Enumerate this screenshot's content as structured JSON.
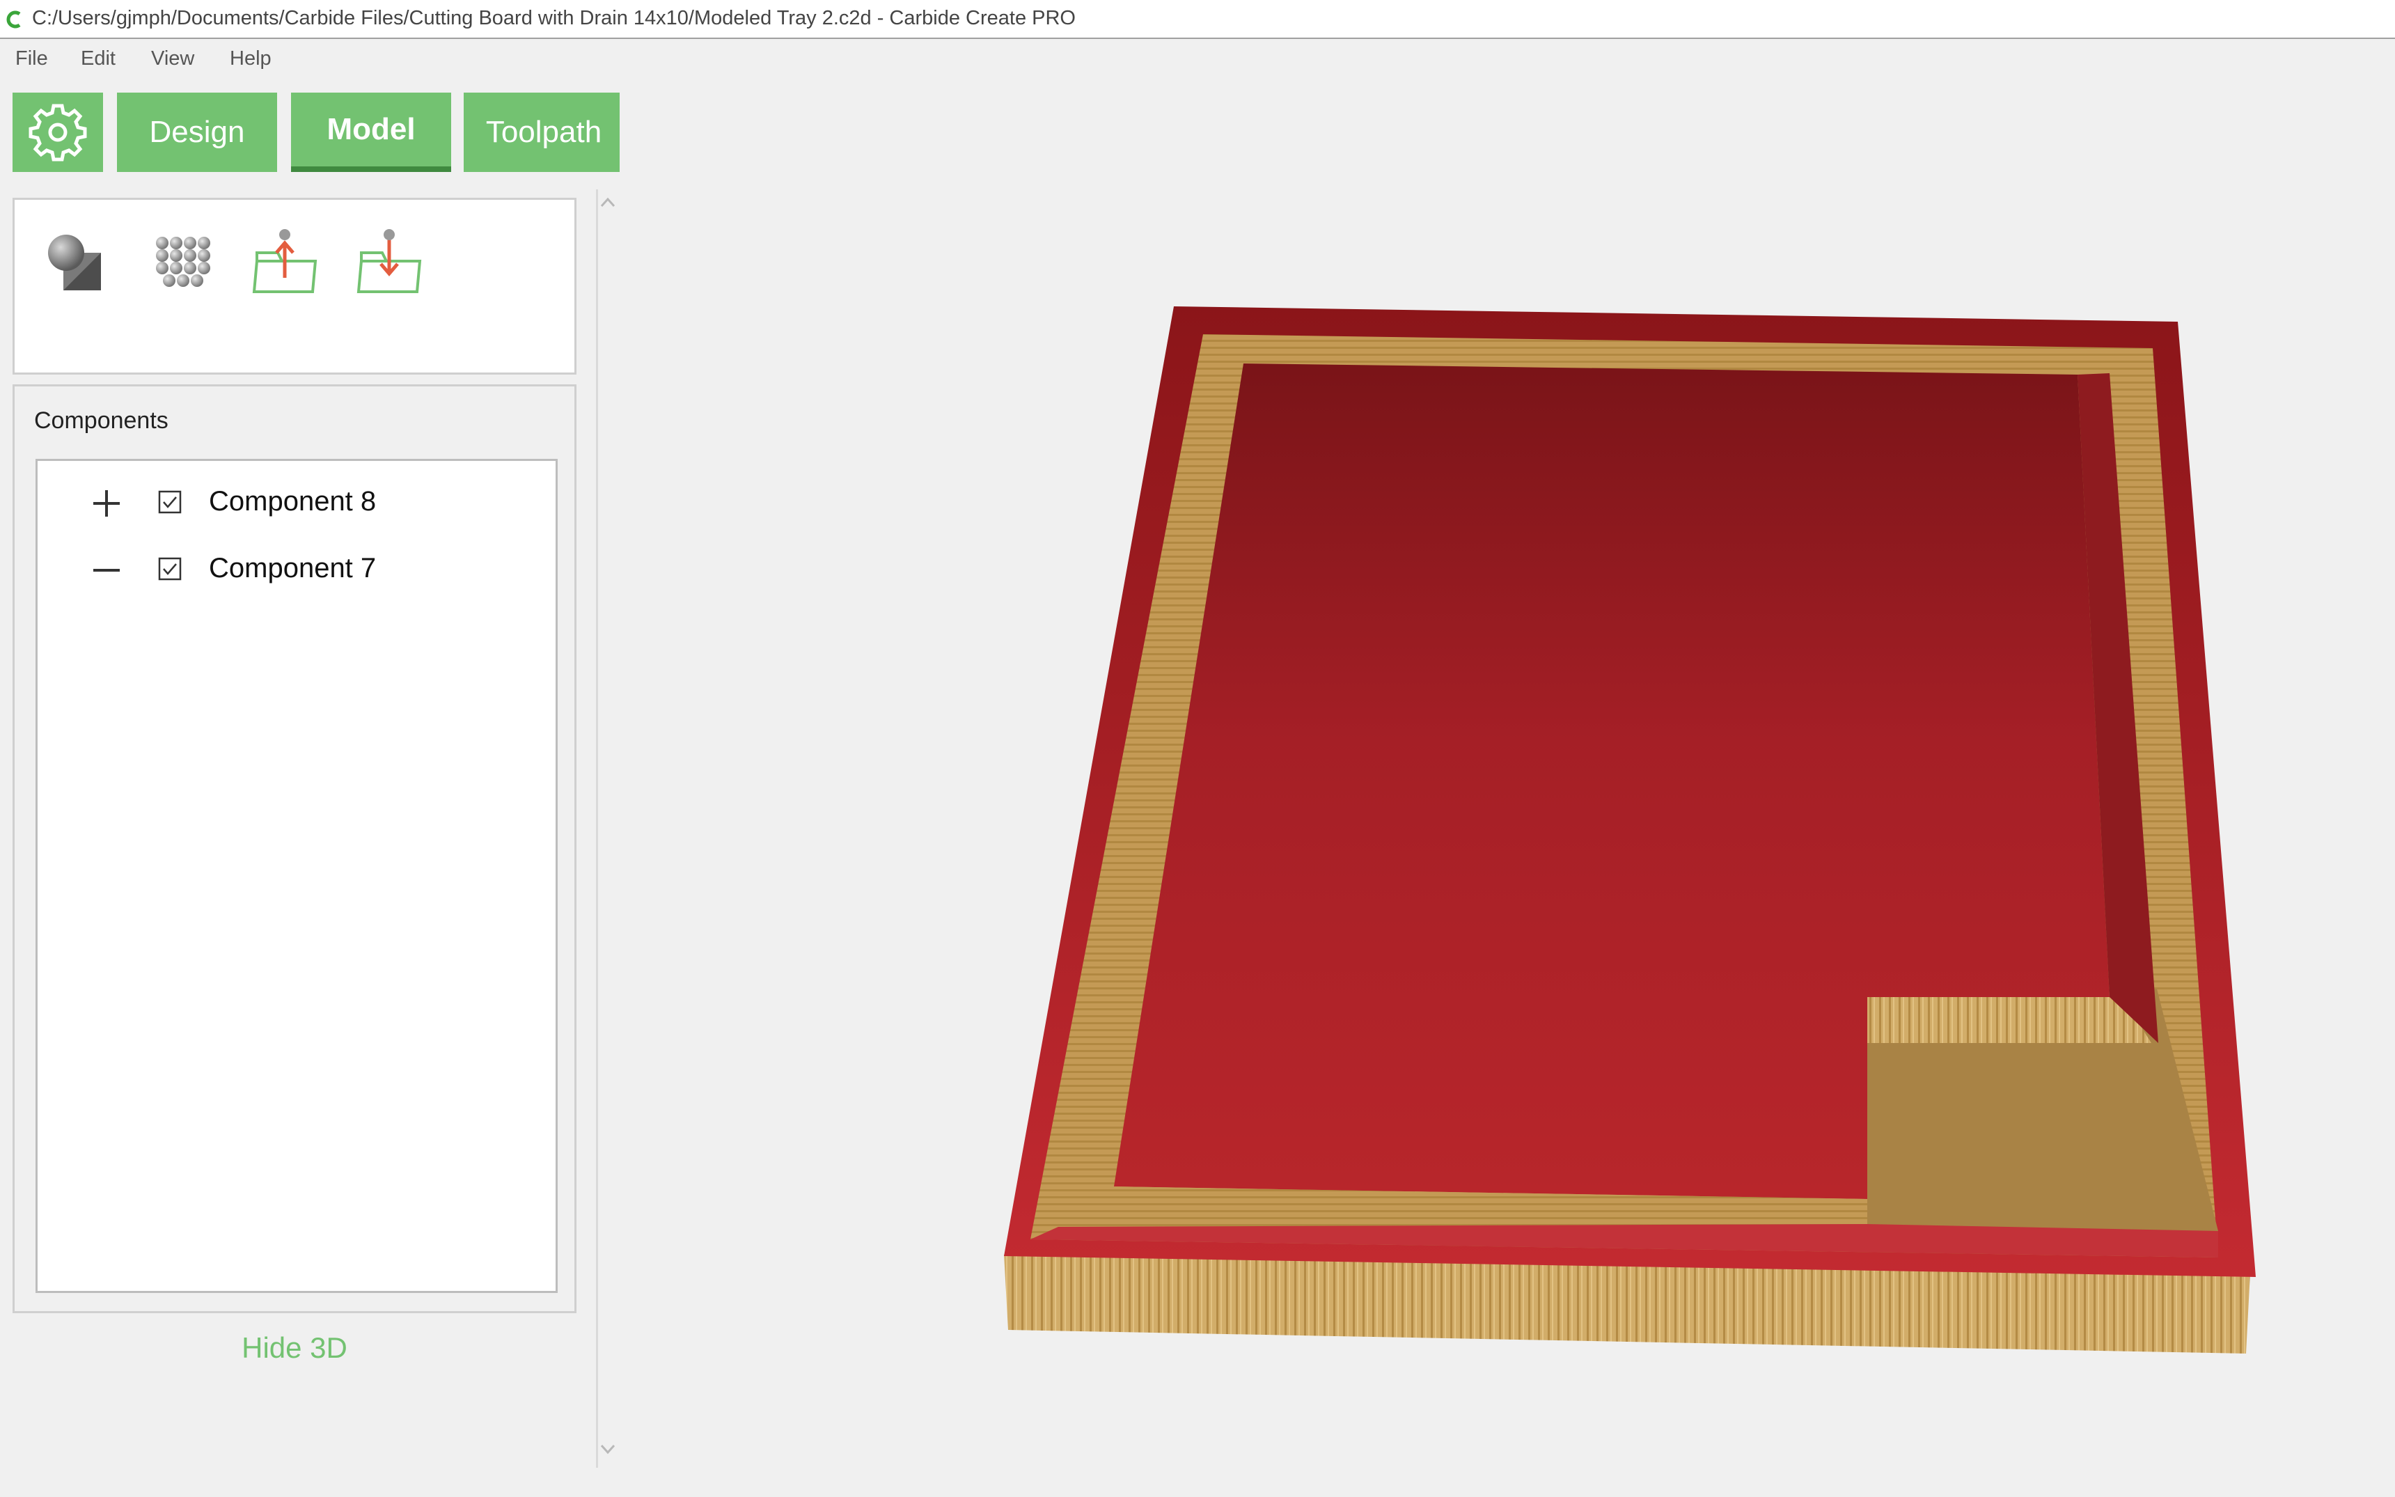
{
  "window": {
    "title": "C:/Users/gjmph/Documents/Carbide Files/Cutting Board with Drain 14x10/Modeled Tray 2.c2d - Carbide Create PRO"
  },
  "menu": {
    "items": [
      "File",
      "Edit",
      "View",
      "Help"
    ]
  },
  "tabs": {
    "settings_icon": "gear-icon",
    "items": [
      {
        "label": "Design",
        "active": false
      },
      {
        "label": "Model",
        "active": true
      },
      {
        "label": "Toolpath",
        "active": false
      }
    ]
  },
  "tools": [
    {
      "icon": "create-component-icon"
    },
    {
      "icon": "pattern-array-icon"
    },
    {
      "icon": "export-folder-icon"
    },
    {
      "icon": "import-folder-icon"
    }
  ],
  "components_panel": {
    "title": "Components",
    "items": [
      {
        "label": "Component 8",
        "expander": "+",
        "checked": true
      },
      {
        "label": "Component 7",
        "expander": "−",
        "checked": true
      }
    ]
  },
  "hide3d_label": "Hide 3D",
  "colors": {
    "accent": "#73c271",
    "accent_dark": "#3f8a3f",
    "model_red": "#b0232a",
    "wood": "#c9a45e"
  }
}
